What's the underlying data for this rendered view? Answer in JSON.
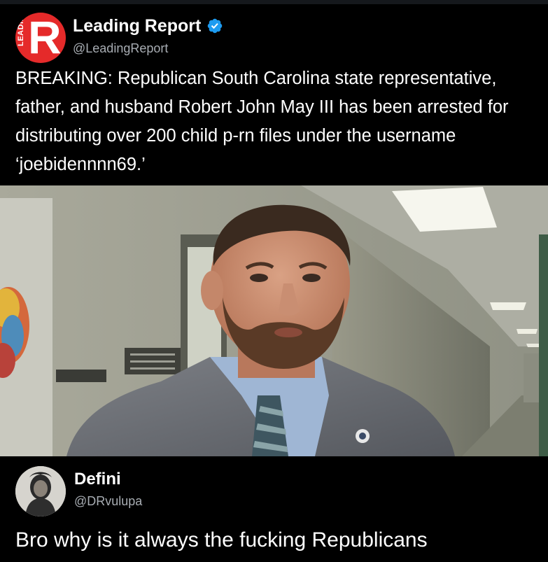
{
  "post": {
    "author": {
      "display_name": "Leading Report",
      "handle": "@LeadingReport",
      "avatar_letter": "R",
      "avatar_side_text": "LEADING",
      "avatar_color": "#e52a2a",
      "verified_icon": "verified-badge-icon",
      "verified_color": "#1d9bf0"
    },
    "text": "BREAKING: Republican South Carolina state representative, father, and husband Robert John May III has been arrested for distributing over 200 child p-rn files under the username ‘joebidennnn69.’",
    "media": {
      "kind": "photo"
    }
  },
  "reply": {
    "author": {
      "display_name": "Defini",
      "handle": "@DRvulupa"
    },
    "text": "Bro why is it always the fucking Republicans"
  }
}
